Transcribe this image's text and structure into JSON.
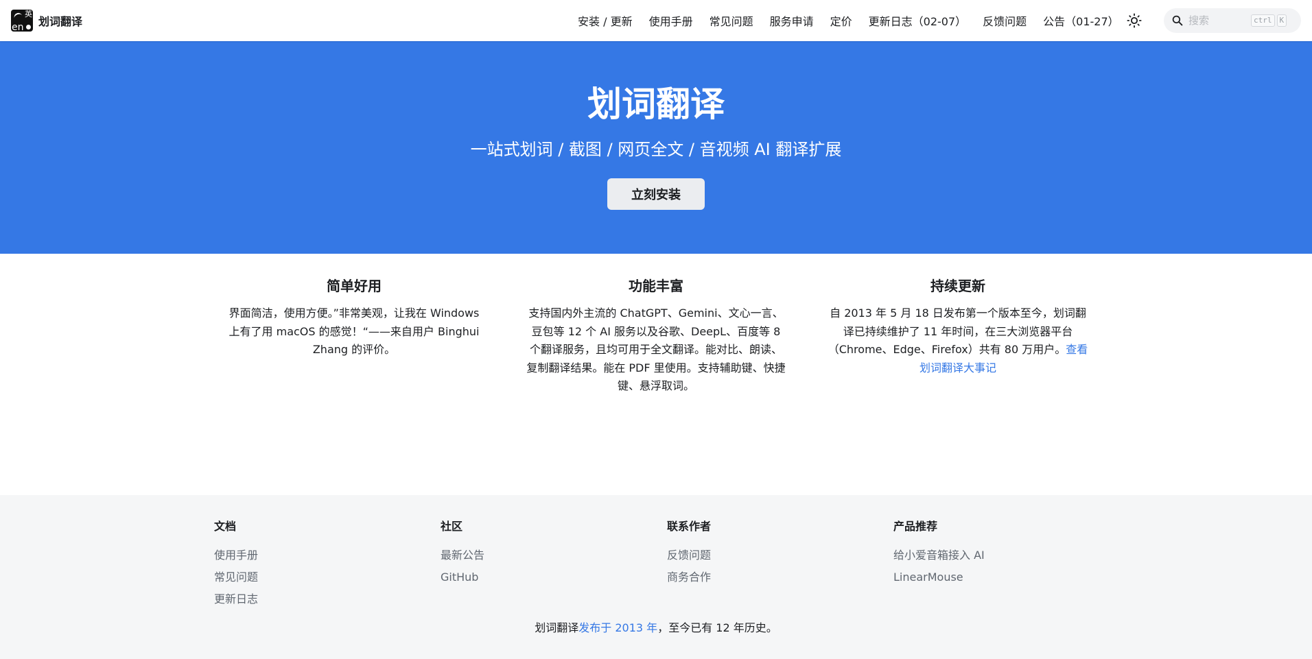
{
  "brand": {
    "title": "划词翻译",
    "logo_text_en": "en",
    "logo_text_zh": "英"
  },
  "nav": {
    "items": [
      {
        "label": "安装 / 更新"
      },
      {
        "label": "使用手册"
      },
      {
        "label": "常见问题"
      },
      {
        "label": "服务申请"
      },
      {
        "label": "定价"
      },
      {
        "label": "更新日志（02-07）"
      },
      {
        "label": "反馈问题"
      },
      {
        "label": "公告（01-27）"
      }
    ],
    "theme_icon": "sun-icon",
    "search": {
      "placeholder": "搜索",
      "shortcut_keys": [
        "ctrl",
        "K"
      ]
    }
  },
  "hero": {
    "title": "划词翻译",
    "subtitle": "一站式划词 / 截图 / 网页全文 / 音视频 AI 翻译扩展",
    "cta_label": "立刻安装"
  },
  "features": [
    {
      "title": "简单好用",
      "text": "界面简洁，使用方便。”非常美观，让我在 Windows 上有了用 macOS 的感觉！“——来自用户 Binghui Zhang 的评价。",
      "link": ""
    },
    {
      "title": "功能丰富",
      "text": "支持国内外主流的 ChatGPT、Gemini、文心一言、豆包等 12 个 AI 服务以及谷歌、DeepL、百度等 8 个翻译服务，且均可用于全文翻译。能对比、朗读、复制翻译结果。能在 PDF 里使用。支持辅助键、快捷键、悬浮取词。",
      "link": ""
    },
    {
      "title": "持续更新",
      "text": "自 2013 年 5 月 18 日发布第一个版本至今，划词翻译已持续维护了 11 年时间，在三大浏览器平台（Chrome、Edge、Firefox）共有 80 万用户。",
      "link": "查看划词翻译大事记"
    }
  ],
  "footer": {
    "columns": [
      {
        "title": "文档",
        "links": [
          "使用手册",
          "常见问题",
          "更新日志"
        ]
      },
      {
        "title": "社区",
        "links": [
          "最新公告",
          "GitHub"
        ]
      },
      {
        "title": "联系作者",
        "links": [
          "反馈问题",
          "商务合作"
        ]
      },
      {
        "title": "产品推荐",
        "links": [
          "给小爱音箱接入 AI",
          "LinearMouse"
        ]
      }
    ],
    "copyright": {
      "prefix": "划词翻译",
      "link": "发布于 2013 年",
      "suffix": "，至今已有 12 年历史。"
    }
  },
  "colors": {
    "primary": "#3578e5",
    "footer_bg": "#f5f6f7",
    "link_muted": "#606770"
  }
}
